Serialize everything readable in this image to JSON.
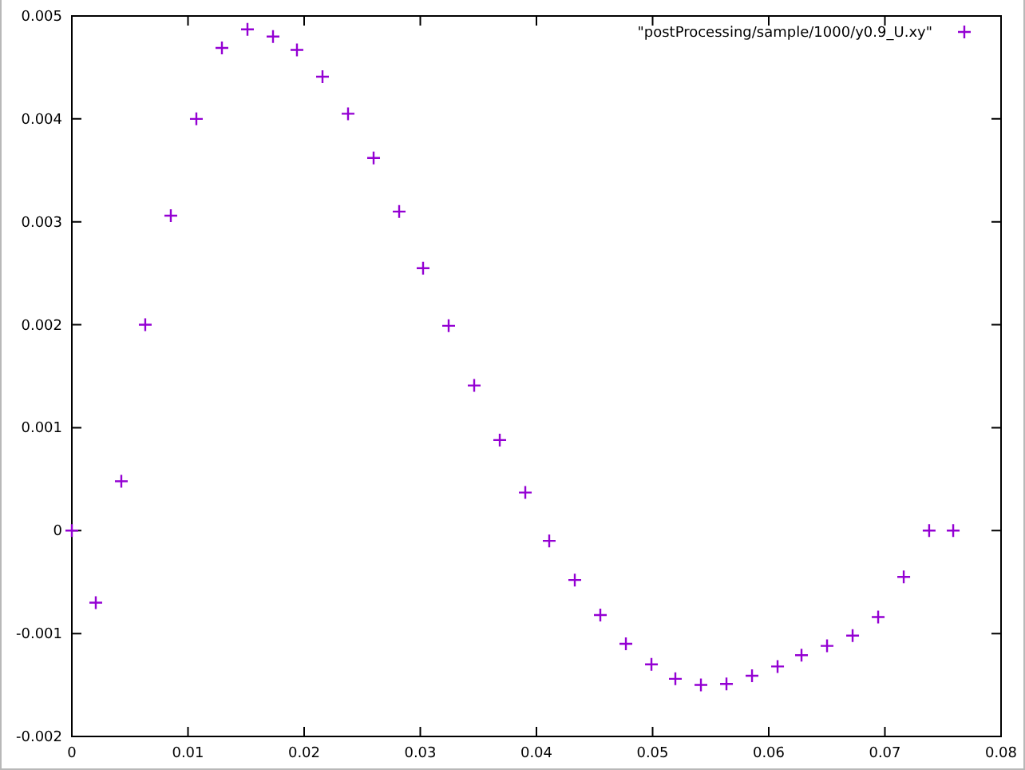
{
  "chart_data": {
    "type": "scatter",
    "xlim": [
      0,
      0.08
    ],
    "ylim": [
      -0.002,
      0.005
    ],
    "xticks": [
      {
        "value": 0,
        "label": "0"
      },
      {
        "value": 0.01,
        "label": "0.01"
      },
      {
        "value": 0.02,
        "label": "0.02"
      },
      {
        "value": 0.03,
        "label": "0.03"
      },
      {
        "value": 0.04,
        "label": "0.04"
      },
      {
        "value": 0.05,
        "label": "0.05"
      },
      {
        "value": 0.06,
        "label": "0.06"
      },
      {
        "value": 0.07,
        "label": "0.07"
      },
      {
        "value": 0.08,
        "label": "0.08"
      }
    ],
    "yticks": [
      {
        "value": -0.002,
        "label": "-0.002"
      },
      {
        "value": -0.001,
        "label": "-0.001"
      },
      {
        "value": 0,
        "label": "0"
      },
      {
        "value": 0.001,
        "label": "0.001"
      },
      {
        "value": 0.002,
        "label": "0.002"
      },
      {
        "value": 0.003,
        "label": "0.003"
      },
      {
        "value": 0.004,
        "label": "0.004"
      },
      {
        "value": 0.005,
        "label": "0.005"
      }
    ],
    "x": [
      0,
      0.00206,
      0.00426,
      0.00632,
      0.00852,
      0.01072,
      0.01292,
      0.01512,
      0.01732,
      0.01938,
      0.02158,
      0.02378,
      0.02598,
      0.02818,
      0.03024,
      0.03244,
      0.03464,
      0.03684,
      0.03904,
      0.0411,
      0.0433,
      0.0455,
      0.0477,
      0.0499,
      0.05196,
      0.05416,
      0.05636,
      0.05856,
      0.06076,
      0.06282,
      0.06502,
      0.06722,
      0.06942,
      0.07162,
      0.07381,
      0.07588
    ],
    "series": [
      {
        "name": "\"postProcessing/sample/1000/y0.9_U.xy\"",
        "color": "#9400d3",
        "values": [
          0,
          -0.0007,
          0.00048,
          0.002,
          0.00306,
          0.004,
          0.00469,
          0.00487,
          0.0048,
          0.00467,
          0.00441,
          0.00405,
          0.00362,
          0.0031,
          0.00255,
          0.00199,
          0.00141,
          0.00088,
          0.00037,
          -0.0001,
          -0.00048,
          -0.00082,
          -0.0011,
          -0.0013,
          -0.00144,
          -0.0015,
          -0.00149,
          -0.00141,
          -0.00132,
          -0.00121,
          -0.00112,
          -0.00102,
          -0.00084,
          -0.00045,
          0,
          0
        ]
      }
    ]
  }
}
